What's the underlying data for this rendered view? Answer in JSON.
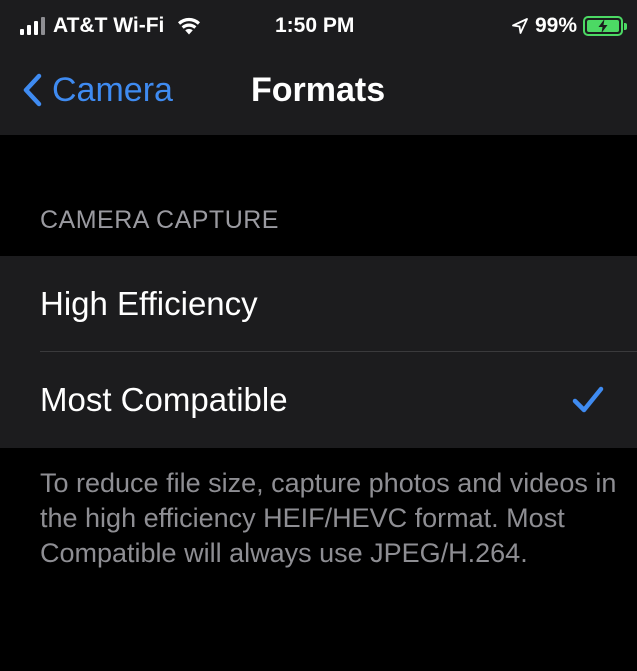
{
  "status_bar": {
    "carrier": "AT&T Wi-Fi",
    "time": "1:50 PM",
    "battery": "99%",
    "battery_color": "#4cd964",
    "icons": [
      "signal-icon",
      "wifi-icon",
      "location-icon",
      "battery-charging-icon"
    ]
  },
  "nav": {
    "back_label": "Camera",
    "title": "Formats",
    "accent_color": "#3f8bf1"
  },
  "section": {
    "header": "CAMERA CAPTURE"
  },
  "options": [
    {
      "label": "High Efficiency",
      "selected": false
    },
    {
      "label": "Most Compatible",
      "selected": true
    }
  ],
  "footer": {
    "text": "To reduce file size, capture photos and videos in the high efficiency HEIF/HEVC format. Most Compatible will always use JPEG/H.264."
  }
}
